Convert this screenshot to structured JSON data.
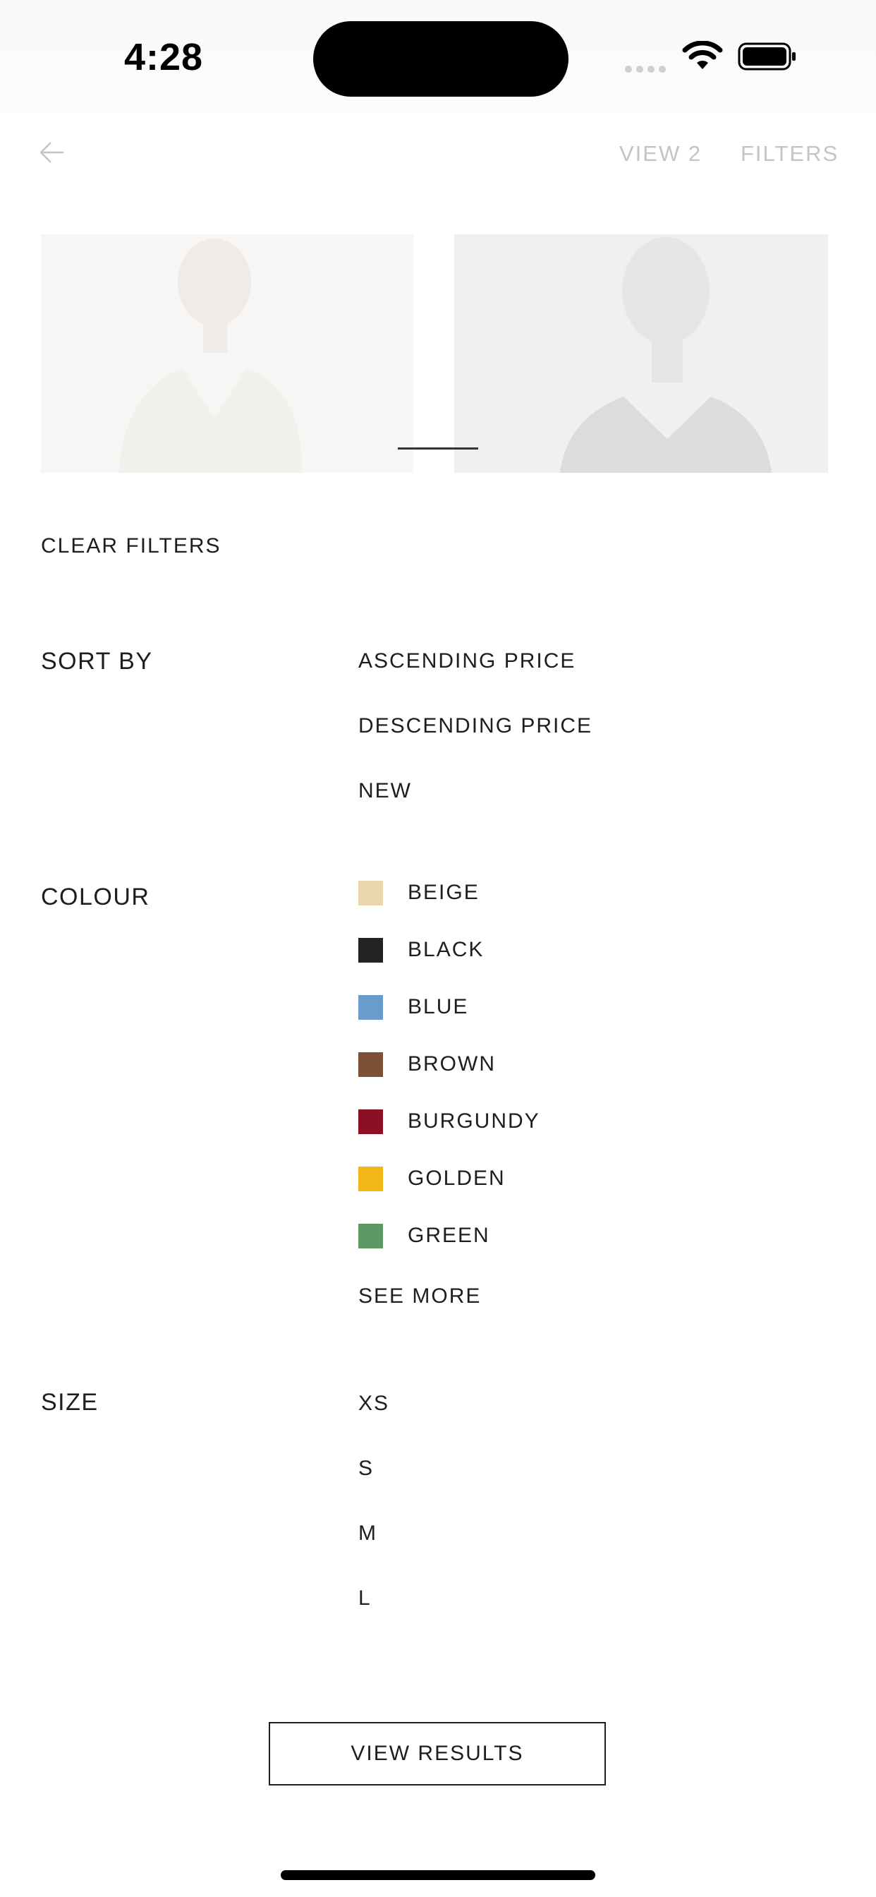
{
  "status_bar": {
    "time": "4:28"
  },
  "header": {
    "view_label": "VIEW 2",
    "filters_label": "FILTERS"
  },
  "filters": {
    "clear_label": "CLEAR FILTERS",
    "sort": {
      "label": "SORT BY",
      "options": [
        "ASCENDING PRICE",
        "DESCENDING PRICE",
        "NEW"
      ]
    },
    "colour": {
      "label": "COLOUR",
      "options": [
        {
          "name": "BEIGE",
          "color": "#E9D5AE"
        },
        {
          "name": "BLACK",
          "color": "#252223"
        },
        {
          "name": "BLUE",
          "color": "#6A9CCB"
        },
        {
          "name": "BROWN",
          "color": "#7C5138"
        },
        {
          "name": "BURGUNDY",
          "color": "#8C0F24"
        },
        {
          "name": "GOLDEN",
          "color": "#F2B617"
        },
        {
          "name": "GREEN",
          "color": "#5E9965"
        }
      ],
      "see_more": "SEE MORE"
    },
    "size": {
      "label": "SIZE",
      "options": [
        "XS",
        "S",
        "M",
        "L"
      ]
    }
  },
  "footer": {
    "view_results_label": "VIEW RESULTS"
  }
}
